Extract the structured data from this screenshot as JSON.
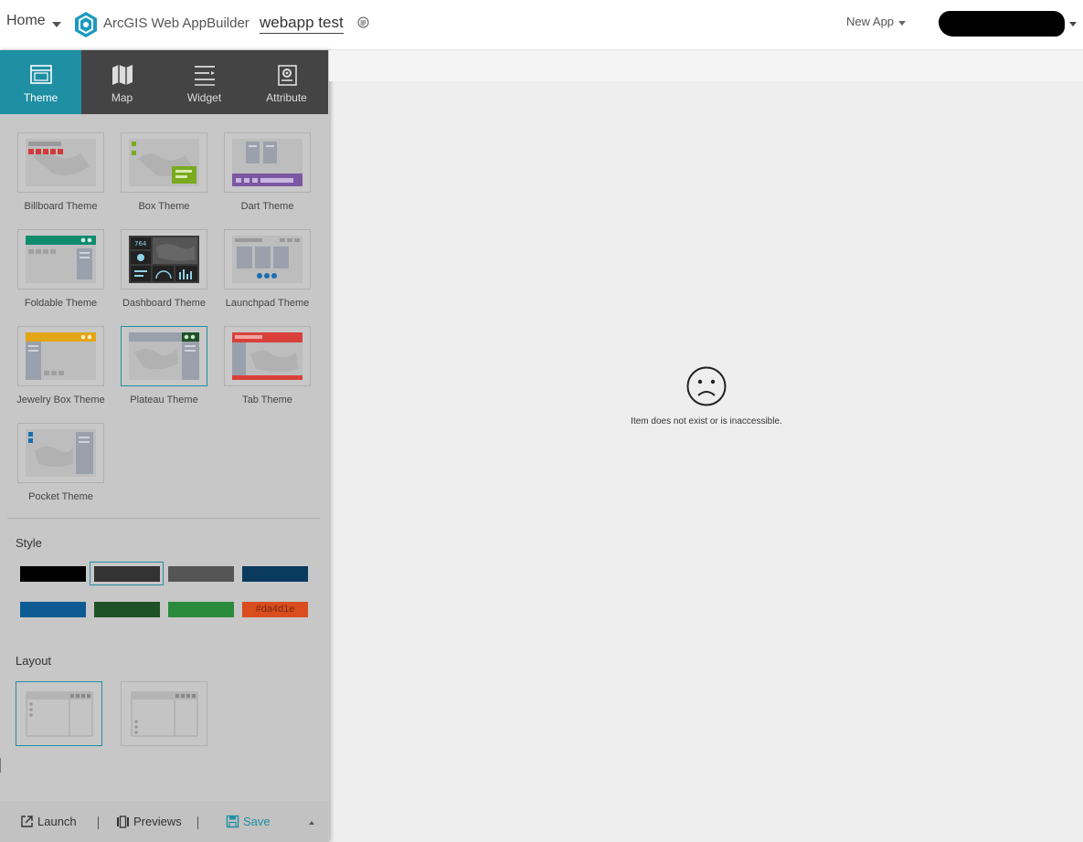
{
  "header": {
    "home_label": "Home",
    "product_name": "ArcGIS Web AppBuilder",
    "app_title": "webapp test",
    "new_app_label": "New App",
    "logo_icon": "arcgis-logo-icon"
  },
  "tabs": [
    {
      "label": "Theme",
      "icon": "theme-window-icon",
      "active": true
    },
    {
      "label": "Map",
      "icon": "map-icon",
      "active": false
    },
    {
      "label": "Widget",
      "icon": "widget-list-icon",
      "active": false
    },
    {
      "label": "Attribute",
      "icon": "attribute-gear-icon",
      "active": false
    }
  ],
  "themes": [
    {
      "label": "Billboard Theme",
      "selected": false
    },
    {
      "label": "Box Theme",
      "selected": false
    },
    {
      "label": "Dart Theme",
      "selected": false
    },
    {
      "label": "Foldable Theme",
      "selected": false
    },
    {
      "label": "Dashboard Theme",
      "selected": false
    },
    {
      "label": "Launchpad Theme",
      "selected": false
    },
    {
      "label": "Jewelry Box Theme",
      "selected": false
    },
    {
      "label": "Plateau Theme",
      "selected": true
    },
    {
      "label": "Tab Theme",
      "selected": false
    },
    {
      "label": "Pocket Theme",
      "selected": false
    }
  ],
  "style": {
    "title": "Style",
    "swatches": [
      "#000000",
      "#333333",
      "#555555",
      "#0a3a5e",
      "#0e5b93",
      "#1e5226",
      "#2a8b3c",
      "#da4d1e"
    ],
    "selected_index": 1,
    "custom_label": "#da4d1e"
  },
  "layout": {
    "title": "Layout",
    "selected_index": 0
  },
  "footer": {
    "launch_label": "Launch",
    "previews_label": "Previews",
    "save_label": "Save"
  },
  "main": {
    "error_message": "Item does not exist or is inaccessible.",
    "error_icon": "sad-face-icon"
  },
  "colors": {
    "accent": "#1f8fa3",
    "tab_bar": "#444444",
    "panel": "#c7c7c7"
  }
}
